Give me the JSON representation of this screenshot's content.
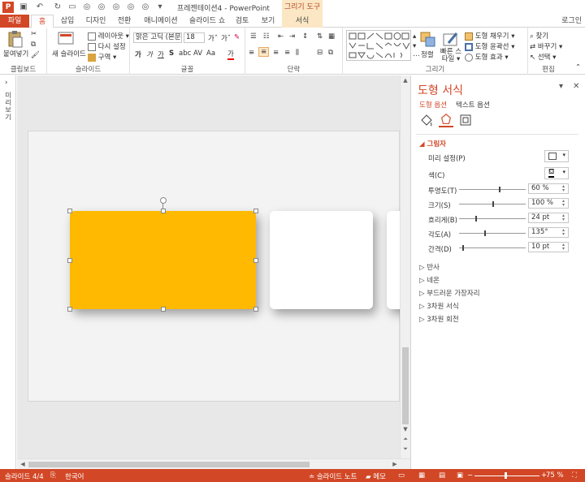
{
  "window": {
    "title": "프레젠테이션4 - PowerPoint",
    "context_title": "그리기 도구"
  },
  "tabs": {
    "file": "파일",
    "home": "홈",
    "insert": "삽입",
    "design": "디자인",
    "transitions": "전환",
    "animations": "애니메이션",
    "slideshow": "슬라이드 쇼",
    "review": "검토",
    "view": "보기",
    "format": "서식",
    "login": "로그인"
  },
  "ribbon": {
    "clipboard": {
      "paste": "붙여넣기",
      "label": "클립보드"
    },
    "slides": {
      "new_slide": "새 슬라이드",
      "layout": "레이아웃 ▾",
      "reset": "다시 설정",
      "section": "구역 ▾",
      "label": "슬라이드"
    },
    "font": {
      "font_name": "맑은 고딕 (본문",
      "font_size": "18",
      "label": "글꼴"
    },
    "paragraph": {
      "label": "단락"
    },
    "drawing": {
      "arrange": "정렬",
      "quick_styles": "빠른 스타일 ▾",
      "fill": "도형 채우기 ▾",
      "outline": "도형 윤곽선 ▾",
      "effects": "도형 효과 ▾",
      "label": "그리기"
    },
    "editing": {
      "find": "찾기",
      "replace": "바꾸기 ▾",
      "select": "선택 ▾",
      "label": "편집"
    }
  },
  "leftbar": {
    "label": "미리보기"
  },
  "pane": {
    "title": "도형 서식",
    "tab_shape": "도형 옵션",
    "tab_text": "텍스트 옵션",
    "shadow": {
      "head": "그림자",
      "preset": "미리 설정(P)",
      "color": "색(C)",
      "transparency_label": "투명도(T)",
      "transparency_value": "60 %",
      "transparency_level": 0.6,
      "size_label": "크기(S)",
      "size_value": "100 %",
      "size_level": 0.5,
      "blur_label": "흐리게(B)",
      "blur_value": "24 pt",
      "blur_level": 0.24,
      "angle_label": "각도(A)",
      "angle_value": "135°",
      "angle_level": 0.375,
      "distance_label": "간격(D)",
      "distance_value": "10 pt",
      "distance_level": 0.05
    },
    "sections": [
      "반사",
      "네온",
      "부드러운 가장자리",
      "3차원 서식",
      "3차원 회전"
    ]
  },
  "statusbar": {
    "slide": "슬라이드 4/4",
    "language": "한국어",
    "notes": "슬라이드 노트",
    "comments": "메모",
    "zoom": "75 %"
  },
  "colors": {
    "accent": "#d24726",
    "shape_fill": "#ffb900"
  }
}
